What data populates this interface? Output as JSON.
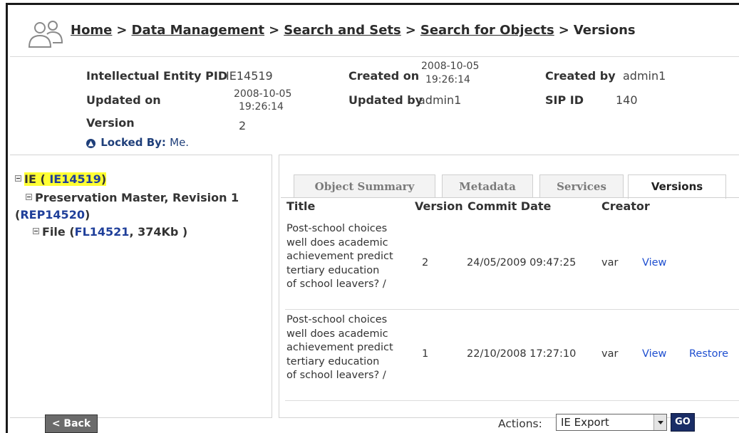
{
  "breadcrumb": {
    "items": [
      "Home",
      "Data Management",
      "Search and Sets",
      "Search for Objects"
    ],
    "current": "Versions",
    "separator": ">"
  },
  "info": {
    "ie_label": "Intellectual Entity PID",
    "ie_value": "IE14519",
    "created_on_label": "Created on",
    "created_on_date": "2008-10-05",
    "created_on_time": "19:26:14",
    "created_by_label": "Created by",
    "created_by_value": "admin1",
    "updated_on_label": "Updated on",
    "updated_on_date": "2008-10-05",
    "updated_on_time": "19:26:14",
    "updated_by_label": "Updated by",
    "updated_by_value": "admin1",
    "sip_label": "SIP ID",
    "sip_value": "140",
    "version_label": "Version",
    "version_value": "2",
    "locked_label": "Locked By:",
    "locked_value": "Me."
  },
  "tree": {
    "ie_prefix": "IE ( ",
    "ie_id": "IE14519",
    "ie_suffix": ")",
    "rep_label": "Preservation Master, Revision 1",
    "rep_id": "REP14520",
    "file_prefix": "File (",
    "file_id": "FL14521",
    "file_suffix": ", 374Kb )"
  },
  "tabs": [
    "Object Summary",
    "Metadata",
    "Services",
    "Versions"
  ],
  "table": {
    "headers": {
      "title": "Title",
      "version": "Version",
      "commit_date": "Commit Date",
      "creator": "Creator"
    },
    "rows": [
      {
        "title_lines": [
          "Post-school choices",
          "well does academic",
          "achievement predict",
          "tertiary education",
          "of school leavers? /"
        ],
        "version": "2",
        "commit_date": "24/05/2009 09:47:25",
        "creator": "var",
        "view": "View",
        "restore": ""
      },
      {
        "title_lines": [
          "Post-school choices",
          "well does academic",
          "achievement predict",
          "tertiary education",
          "of school leavers? /"
        ],
        "version": "1",
        "commit_date": "22/10/2008 17:27:10",
        "creator": "var",
        "view": "View",
        "restore": "Restore"
      }
    ]
  },
  "footer": {
    "back_label": "< Back",
    "actions_label": "Actions:",
    "actions_selected": "IE Export",
    "go_label": "GO"
  },
  "colors": {
    "link": "#1f4fd0",
    "tree_link": "#1f3f9a",
    "highlight": "#ffff33",
    "go_button": "#1a2d66",
    "back_button": "#6b6b6b"
  },
  "icons": [
    "people-icon",
    "lock-icon",
    "tree-toggle-icon",
    "dropdown-arrow-icon"
  ]
}
